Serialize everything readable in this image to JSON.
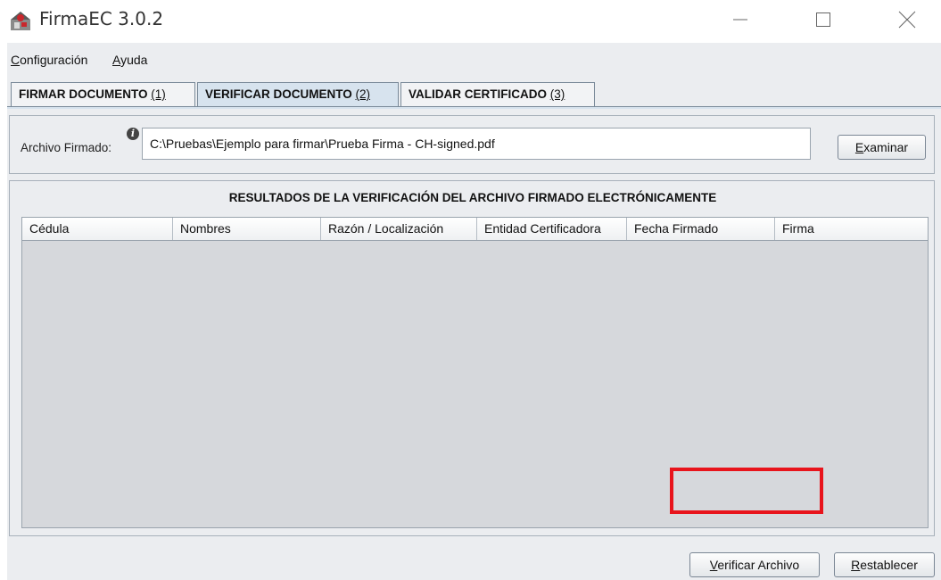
{
  "window": {
    "title": "FirmaEC 3.0.2"
  },
  "menu": {
    "configuracion_first": "C",
    "configuracion_rest": "onfiguración",
    "ayuda_first": "A",
    "ayuda_rest": "yuda"
  },
  "tabs": [
    {
      "label": "FIRMAR DOCUMENTO ",
      "mnemonic": "(1)",
      "active": false
    },
    {
      "label": "VERIFICAR DOCUMENTO ",
      "mnemonic": "(2)",
      "active": true
    },
    {
      "label": "VALIDAR CERTIFICADO ",
      "mnemonic": "(3)",
      "active": false
    }
  ],
  "file": {
    "label": "Archivo Firmado:",
    "value": "C:\\Pruebas\\Ejemplo para firmar\\Prueba Firma - CH-signed.pdf",
    "browse_first": "E",
    "browse_rest": "xaminar"
  },
  "results": {
    "title": "RESULTADOS DE LA VERIFICACIÓN DEL ARCHIVO FIRMADO ELECTRÓNICAMENTE",
    "columns": [
      "Cédula",
      "Nombres",
      "Razón / Localización",
      "Entidad Certificadora",
      "Fecha Firmado",
      "Firma"
    ]
  },
  "actions": {
    "verify_first": "V",
    "verify_rest": "erificar Archivo",
    "reset_first": "R",
    "reset_rest": "establecer"
  },
  "colors": {
    "highlight": "#e8141c",
    "active_tab": "#d7e3ee"
  }
}
